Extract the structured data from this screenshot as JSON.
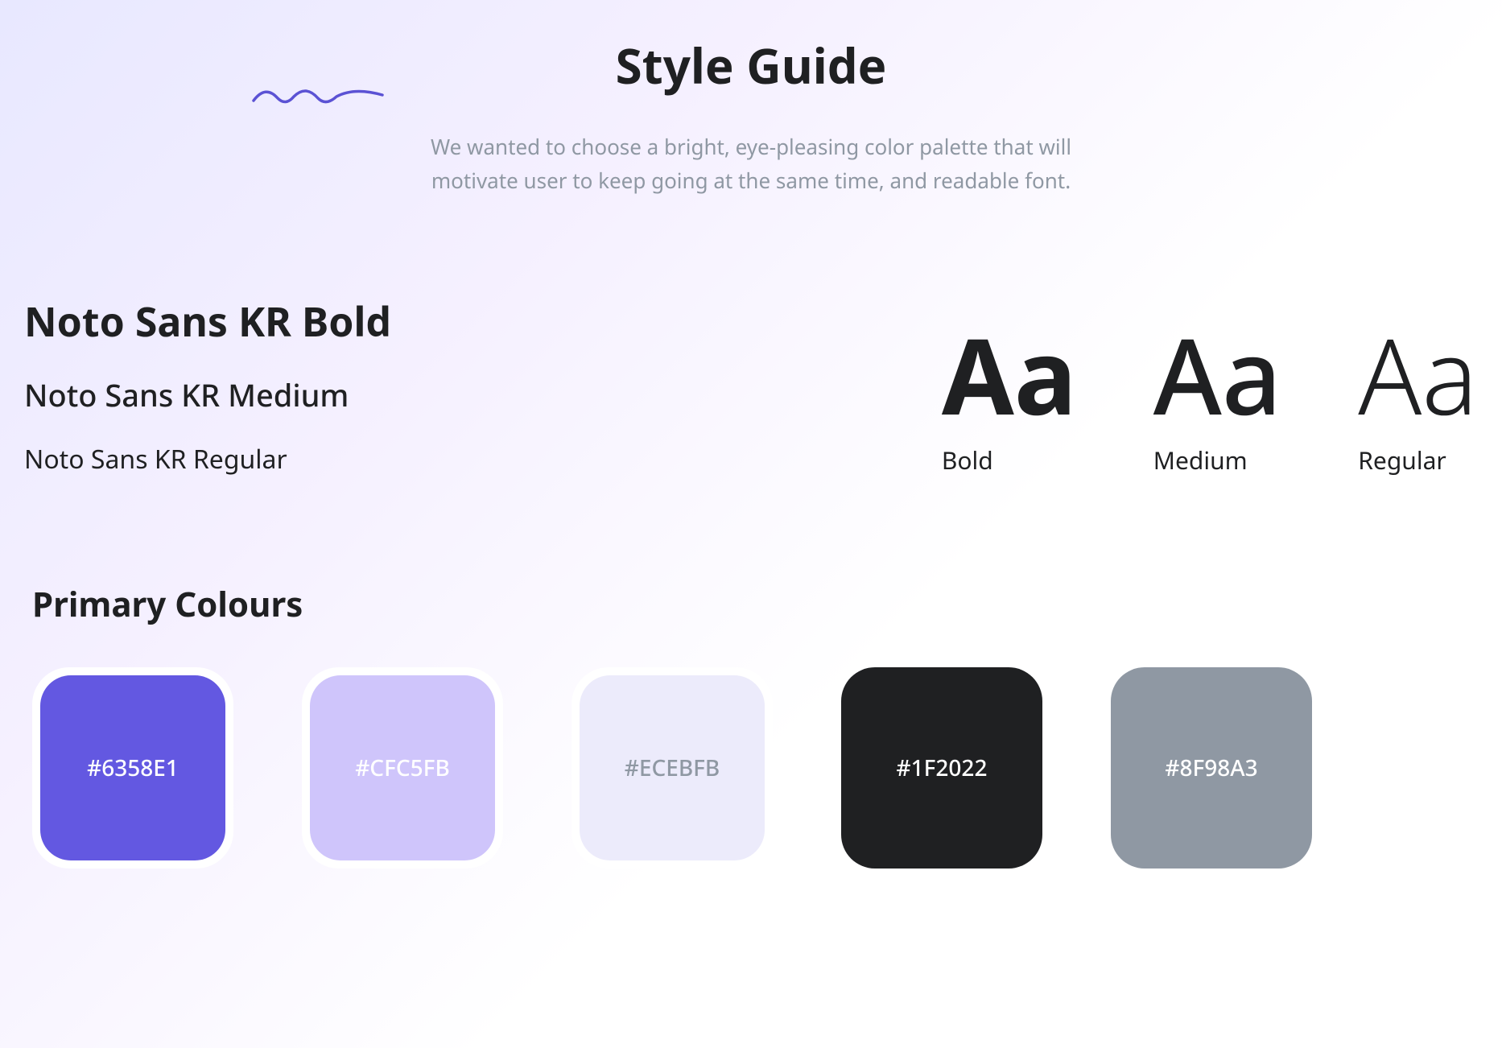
{
  "header": {
    "title": "Style Guide",
    "description": "We wanted to choose a bright, eye-pleasing color palette that will motivate user to keep going at the same time, and readable font."
  },
  "typography": {
    "fonts": {
      "bold": "Noto Sans KR Bold",
      "medium": "Noto Sans KR Medium",
      "regular": "Noto Sans KR Regular"
    },
    "samples": {
      "glyph": "Aa",
      "bold_label": "Bold",
      "medium_label": "Medium",
      "regular_label": "Regular"
    }
  },
  "colors": {
    "title": "Primary Colours",
    "swatches": [
      {
        "hex": "#6358E1",
        "text_class": "light-text",
        "wrapped": true
      },
      {
        "hex": "#CFC5FB",
        "text_class": "light-text",
        "wrapped": true
      },
      {
        "hex": "#ECEBFB",
        "text_class": "dark-text",
        "wrapped": true
      },
      {
        "hex": "#1F2022",
        "text_class": "light-text",
        "wrapped": false
      },
      {
        "hex": "#8F98A3",
        "text_class": "light-text",
        "wrapped": false
      }
    ]
  }
}
